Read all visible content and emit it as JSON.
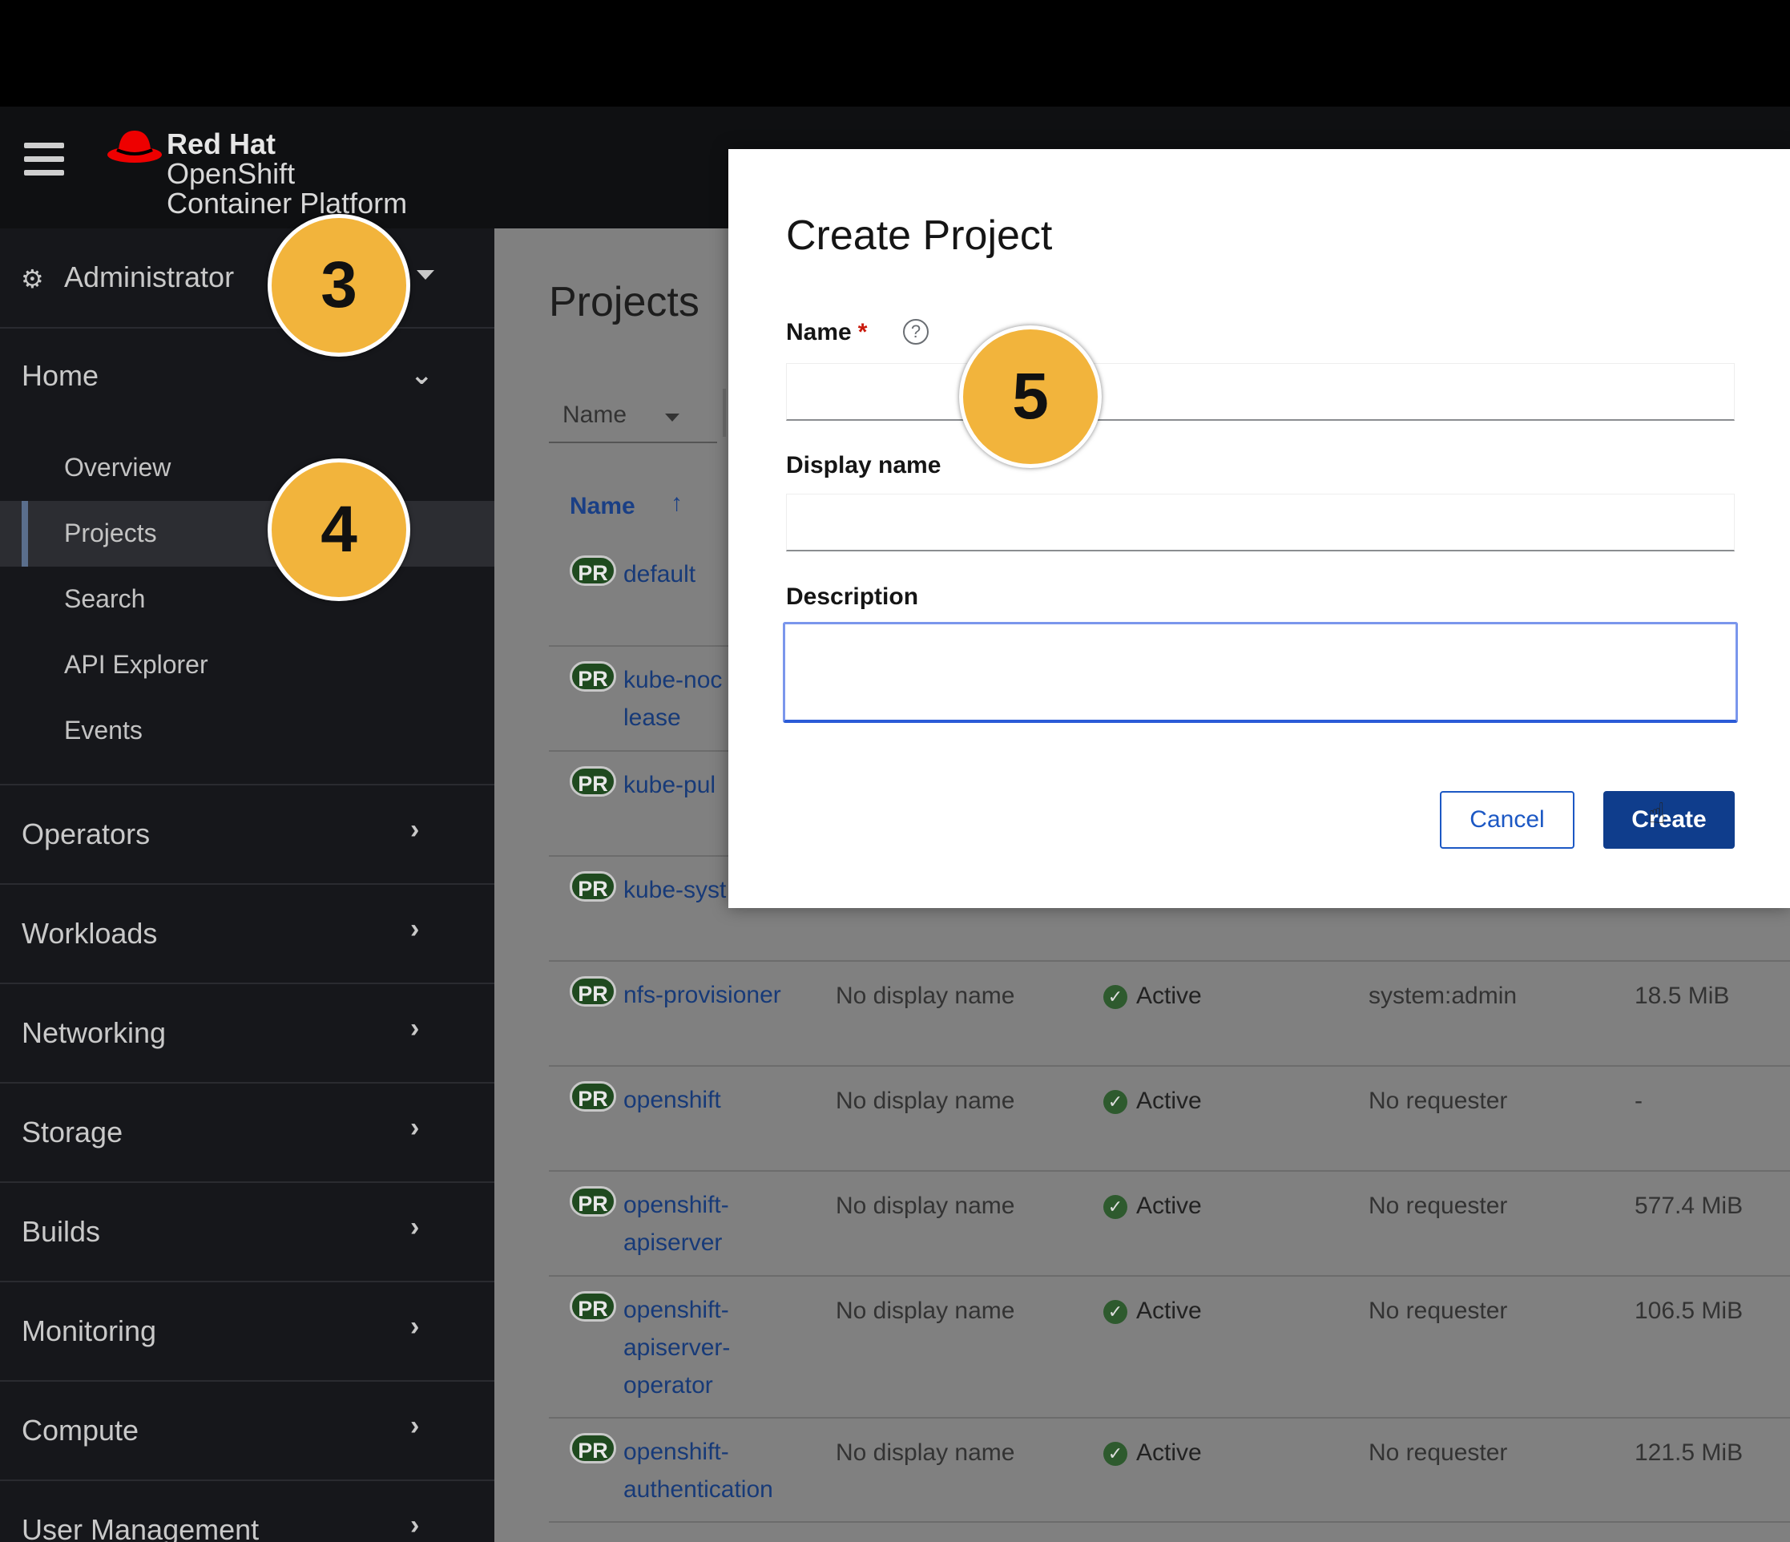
{
  "header": {
    "brand_line1": "Red Hat",
    "brand_line2": "OpenShift",
    "brand_line3": "Container Platform",
    "menu_icon": "hamburger-icon",
    "logo_icon": "red-hat-fedora-logo"
  },
  "sidebar": {
    "perspective": {
      "icon": "gears-icon",
      "label": "Administrator"
    },
    "home": {
      "label": "Home",
      "items": [
        {
          "label": "Overview"
        },
        {
          "label": "Projects"
        },
        {
          "label": "Search"
        },
        {
          "label": "API Explorer"
        },
        {
          "label": "Events"
        }
      ]
    },
    "sections": [
      {
        "label": "Operators"
      },
      {
        "label": "Workloads"
      },
      {
        "label": "Networking"
      },
      {
        "label": "Storage"
      },
      {
        "label": "Builds"
      },
      {
        "label": "Monitoring"
      },
      {
        "label": "Compute"
      },
      {
        "label": "User Management"
      }
    ]
  },
  "main": {
    "title": "Projects",
    "filter": {
      "selected": "Name"
    },
    "table": {
      "name_header": "Name",
      "sort_icon": "sort-ascending-icon",
      "badge": "PR",
      "rows": [
        {
          "name": "default",
          "display": "",
          "status": "",
          "requester": "",
          "memory": ""
        },
        {
          "name": "kube-noc\nlease",
          "display": "",
          "status": "",
          "requester": "",
          "memory": ""
        },
        {
          "name": "kube-pul",
          "display": "",
          "status": "",
          "requester": "",
          "memory": ""
        },
        {
          "name": "kube-syst",
          "display": "",
          "status": "",
          "requester": "",
          "memory": ""
        },
        {
          "name": "nfs-provisioner",
          "display": "No display name",
          "status": "Active",
          "requester": "system:admin",
          "memory": "18.5 MiB"
        },
        {
          "name": "openshift",
          "display": "No display name",
          "status": "Active",
          "requester": "No requester",
          "memory": "-"
        },
        {
          "name": "openshift-\napiserver",
          "display": "No display name",
          "status": "Active",
          "requester": "No requester",
          "memory": "577.4 MiB"
        },
        {
          "name": "openshift-\napiserver-\noperator",
          "display": "No display name",
          "status": "Active",
          "requester": "No requester",
          "memory": "106.5 MiB"
        },
        {
          "name": "openshift-\nauthentication",
          "display": "No display name",
          "status": "Active",
          "requester": "No requester",
          "memory": "121.5 MiB"
        }
      ]
    }
  },
  "modal": {
    "title": "Create Project",
    "name_label": "Name",
    "required_mark": "*",
    "help_icon": "question-circle-icon",
    "name_value": "",
    "display_name_label": "Display name",
    "display_name_value": "",
    "description_label": "Description",
    "description_value": "",
    "cancel_label": "Cancel",
    "create_label": "Create"
  },
  "callouts": [
    "3",
    "4",
    "5"
  ]
}
